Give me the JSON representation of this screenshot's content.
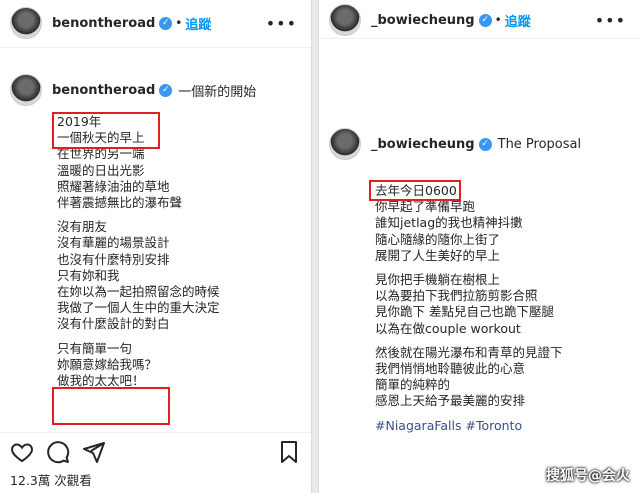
{
  "left_post": {
    "username": "benontheroad",
    "follow": "追蹤",
    "more": "•••",
    "caption_author": "benontheroad",
    "caption_title": "一個新的開始",
    "lines": [
      "2019年",
      "一個秋天的早上",
      "在世界的另一端",
      "溫暖的日出光影",
      "照耀著綠油油的草地",
      "伴著震撼無比的瀑布聲"
    ],
    "lines2": [
      "沒有朋友",
      "沒有華麗的場景設計",
      "也沒有什麼特別安排",
      "只有妳和我",
      "在妳以為一起拍照留念的時候",
      "我做了一個人生中的重大決定",
      "沒有什麼設計的對白"
    ],
    "lines3": [
      "只有簡單一句",
      "妳願意嫁給我嗎？",
      "做我的太太吧！"
    ],
    "views": "12.3萬 次觀看"
  },
  "right_post": {
    "username": "_bowiecheung",
    "follow": "追蹤",
    "more": "•••",
    "caption_author": "_bowiecheung",
    "caption_title": "The Proposal",
    "lines": [
      "去年今日0600",
      "你早起了準備早跑",
      "誰知jetlag的我也精神抖擻",
      "隨心隨緣的隨你上街了",
      "展開了人生美好的早上"
    ],
    "lines2": [
      "見你把手機躺在樹根上",
      "以為要拍下我們拉筋剪影合照",
      "見你跪下 差點兒自己也跪下壓腿",
      "以為在做couple workout"
    ],
    "lines3": [
      "然後就在陽光瀑布和青草的見證下",
      "我們悄悄地聆聽彼此的心意",
      "簡單的純粹的",
      "感恩上天給予最美麗的安排"
    ],
    "tags": "#NiagaraFalls #Toronto"
  },
  "watermark": "搜狐号@会火",
  "colors": {
    "follow_blue": "#0095f6",
    "verified_blue": "#3897f0",
    "highlight_red": "#e02020",
    "hashtag": "#385185"
  }
}
